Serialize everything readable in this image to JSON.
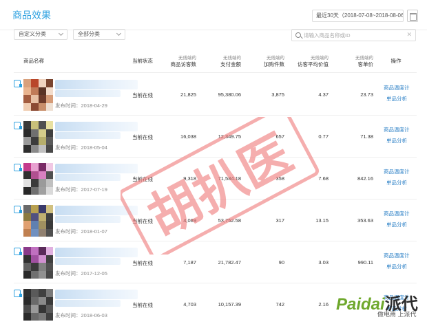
{
  "header": {
    "title": "商品效果",
    "date_range": "最近30天（2018-07-08~2018-08-06）"
  },
  "filters": {
    "custom_category": "自定义分类",
    "all_category": "全部分类",
    "search_placeholder": "请输入商品名称或ID"
  },
  "columns": {
    "name": "商品名称",
    "status": "当前状态",
    "visitors": {
      "sub": "无线端的",
      "label": "商品访客数"
    },
    "pay_amount": {
      "sub": "无线端的",
      "label": "支付金额"
    },
    "cart_count": {
      "sub": "无线端的",
      "label": "加购件数"
    },
    "avg_value": {
      "sub": "无线端的",
      "label": "访客平均价值"
    },
    "unit_price": {
      "sub": "无线端的",
      "label": "客单价"
    },
    "action": "操作"
  },
  "rows": [
    {
      "publish": "发布时间：2018-04-29",
      "status": "当前在线",
      "visitors": "21,825",
      "pay": "95,380.06",
      "cart": "3,875",
      "avg": "4.37",
      "unit": "23.73"
    },
    {
      "publish": "发布时间：2018-05-04",
      "status": "当前在线",
      "visitors": "16,038",
      "pay": "12,349.75",
      "cart": "657",
      "avg": "0.77",
      "unit": "71.38"
    },
    {
      "publish": "发布时间：2017-07-19",
      "status": "当前在线",
      "visitors": "9,318",
      "pay": "71,584.18",
      "cart": "358",
      "avg": "7.68",
      "unit": "842.16"
    },
    {
      "publish": "发布时间：2018-01-07",
      "status": "当前在线",
      "visitors": "4,089",
      "pay": "53,752.58",
      "cart": "317",
      "avg": "13.15",
      "unit": "353.63"
    },
    {
      "publish": "发布时间：2017-12-05",
      "status": "当前在线",
      "visitors": "7,187",
      "pay": "21,782.47",
      "cart": "90",
      "avg": "3.03",
      "unit": "990.11"
    },
    {
      "publish": "发布时间：2018-06-03",
      "status": "当前在线",
      "visitors": "4,703",
      "pay": "10,157.39",
      "cart": "742",
      "avg": "2.16",
      "unit": ""
    }
  ],
  "actions": {
    "temp": "商品温度计",
    "analysis": "单品分析"
  },
  "watermark": {
    "text": "胡扒医",
    "color": "#f07a7a"
  },
  "logo": {
    "text": "Paidai",
    "cn": "派代",
    "slogan": "做电商 上派代"
  },
  "colors": {
    "accent": "#2ea1e0",
    "link": "#2a7fc6"
  }
}
